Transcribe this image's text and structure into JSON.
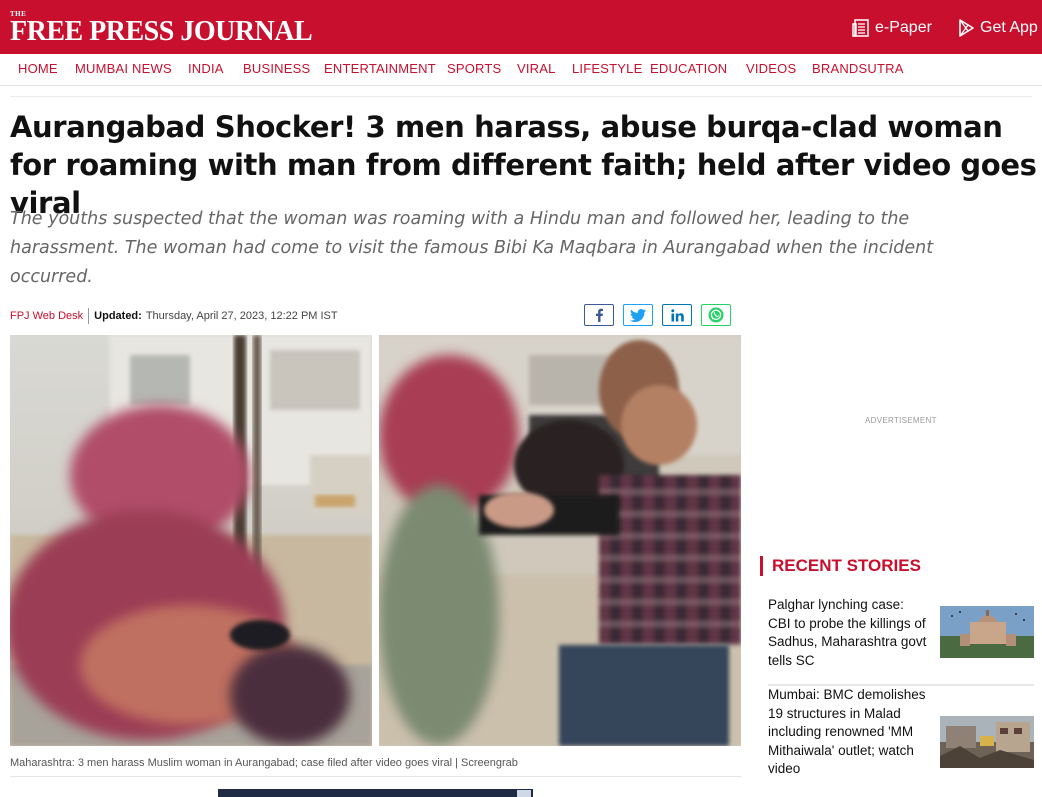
{
  "brand": {
    "the": "THE",
    "name": "FREE PRESS JOURNAL",
    "color": "#c8102e"
  },
  "header": {
    "epaper_label": "e-Paper",
    "getapp_label": "Get App"
  },
  "nav": {
    "items": [
      {
        "label": "HOME"
      },
      {
        "label": "MUMBAI NEWS"
      },
      {
        "label": "INDIA"
      },
      {
        "label": "BUSINESS"
      },
      {
        "label": "ENTERTAINMENT"
      },
      {
        "label": "SPORTS"
      },
      {
        "label": "VIRAL"
      },
      {
        "label": "LIFESTYLE"
      },
      {
        "label": "EDUCATION"
      },
      {
        "label": "VIDEOS"
      },
      {
        "label": "BRANDSUTRA"
      }
    ]
  },
  "article": {
    "headline": "Aurangabad Shocker! 3 men harass, abuse burqa-clad woman for roaming with man from different faith; held after video goes viral",
    "summary": "The youths suspected that the woman was roaming with a Hindu man and followed her, leading to the harassment. The woman had come to visit the famous Bibi Ka Maqbara in Aurangabad when the incident occurred.",
    "author": "FPJ Web Desk",
    "updated_label": "Updated:",
    "updated_value": "Thursday, April 27, 2023, 12:22 PM IST",
    "share_icons": [
      "facebook-icon",
      "twitter-icon",
      "linkedin-icon",
      "whatsapp-icon"
    ],
    "image_caption": "Maharashtra: 3 men harass Muslim woman in Aurangabad; case filed after video goes viral | Screengrab"
  },
  "sidebar": {
    "advertisement_label": "ADVERTISEMENT",
    "recent_title": "RECENT STORIES",
    "stories": [
      {
        "title": "Palghar lynching case: CBI to probe the killings of Sadhus, Maharashtra govt tells SC"
      },
      {
        "title": "Mumbai: BMC demolishes 19 structures in Malad including renowned 'MM Mithaiwala' outlet; watch video"
      }
    ]
  }
}
